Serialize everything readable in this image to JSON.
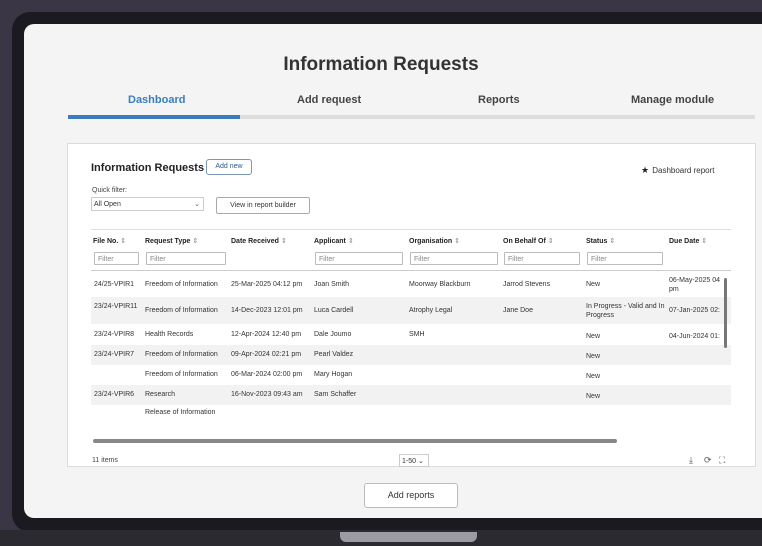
{
  "page": {
    "title": "Information Requests"
  },
  "tabs": [
    {
      "label": "Dashboard",
      "active": true
    },
    {
      "label": "Add request",
      "active": false
    },
    {
      "label": "Reports",
      "active": false
    },
    {
      "label": "Manage module",
      "active": false
    }
  ],
  "panel": {
    "title": "Information Requests",
    "add_new_label": "Add new",
    "dashboard_report_label": "Dashboard report",
    "quick_filter_label": "Quick filter:",
    "quick_filter_value": "All Open",
    "view_report_builder_label": "View in report builder"
  },
  "table": {
    "columns": [
      "File No.",
      "Request Type",
      "Date Received",
      "Applicant",
      "Organisation",
      "On Behalf Of",
      "Status",
      "Due Date"
    ],
    "filter_placeholder": "Filter",
    "rows": [
      [
        "24/25-VPIR1",
        "Freedom of Information",
        "25-Mar-2025 04:12 pm",
        "Joan Smith",
        "Moorway Blackburn",
        "Jarrod Stevens",
        "New",
        "06-May-2025 04 pm"
      ],
      [
        "23/24-VPIR11",
        "Freedom of Information",
        "14-Dec-2023 12:01 pm",
        "Luca Cardell",
        "Atrophy Legal",
        "Jane Doe",
        "In Progress - Valid and In Progress",
        "07-Jan-2025 02:"
      ],
      [
        "23/24-VPIR8",
        "Health Records",
        "12-Apr-2024 12:40 pm",
        "Dale Joumo",
        "SMH",
        "",
        "New",
        "04-Jun-2024 01:"
      ],
      [
        "23/24-VPIR7",
        "Freedom of Information",
        "09-Apr-2024 02:21 pm",
        "Pearl Valdez",
        "",
        "",
        "New",
        ""
      ],
      [
        "",
        "Freedom of Information",
        "06-Mar-2024 02:00 pm",
        "Mary Hogan",
        "",
        "",
        "New",
        ""
      ],
      [
        "23/24-VPIR6",
        "Research",
        "16-Nov-2023 09:43 am",
        "Sam Schaffer",
        "",
        "",
        "New",
        ""
      ],
      [
        "",
        "Release of Information",
        "",
        "",
        "",
        "",
        "",
        ""
      ]
    ]
  },
  "footer": {
    "items_count": "11 items",
    "page_size": "1-50",
    "download_icon": "download-icon",
    "refresh_icon": "refresh-icon",
    "expand_icon": "expand-icon"
  },
  "add_reports_label": "Add reports",
  "colors": {
    "accent": "#3a7dbd",
    "bezel": "#1b1a21",
    "background": "#3a3645"
  }
}
